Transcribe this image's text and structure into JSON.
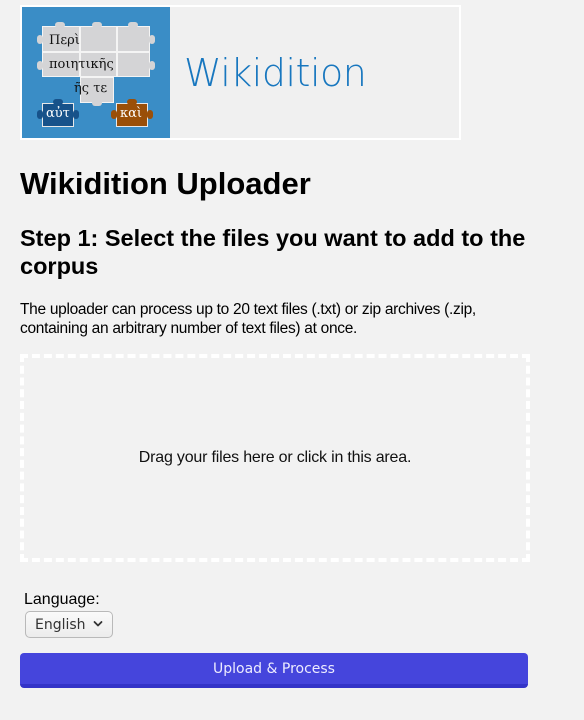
{
  "logo": {
    "title": "Wikidition",
    "puzzle_text": [
      "Περὶ",
      "ποιητικῆς",
      "ῆς τε",
      "αὐτ",
      "καὶ"
    ],
    "colors": {
      "background": "#3a8dc6",
      "piece": "#d4d4d6",
      "piece_blue": "#17528a",
      "piece_brown": "#9a4f08",
      "title": "#1877bf"
    }
  },
  "page": {
    "title": "Wikidition Uploader",
    "step_heading": "Step 1: Select the files you want to add to the corpus",
    "description": "The uploader can process up to 20 text files (.txt) or zip archives (.zip, containing an arbitrary number of text files) at once."
  },
  "dropzone": {
    "label": "Drag your files here or click in this area."
  },
  "language": {
    "label": "Language:",
    "selected": "English",
    "icon": "chevron-down-icon"
  },
  "upload": {
    "label": "Upload & Process",
    "color": "#4545dc"
  }
}
